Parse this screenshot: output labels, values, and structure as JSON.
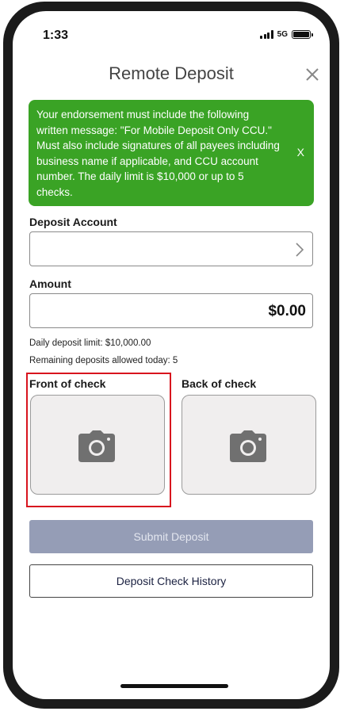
{
  "status_bar": {
    "time": "1:33",
    "network": "5G",
    "icons": [
      "signal-icon",
      "battery-icon"
    ]
  },
  "header": {
    "title": "Remote Deposit",
    "close_icon": "close-icon"
  },
  "banner": {
    "message": "Your endorsement must include the following written message: \"For Mobile Deposit Only CCU.\" Must also include signatures of all payees including business name if applicable, and CCU account number. The daily limit is $10,000 or up to 5 checks.",
    "dismiss_label": "X",
    "background_color": "#3aa325"
  },
  "deposit_account": {
    "label": "Deposit Account",
    "value": "",
    "icon": "chevron-right-icon"
  },
  "amount": {
    "label": "Amount",
    "value": "$0.00"
  },
  "limits": {
    "daily_limit": "Daily deposit limit: $10,000.00",
    "remaining": "Remaining deposits allowed today: 5"
  },
  "checks": {
    "front_label": "Front of check",
    "back_label": "Back of check",
    "icon": "camera-icon",
    "highlight_color": "#d8141e"
  },
  "actions": {
    "submit_label": "Submit Deposit",
    "submit_color": "#959db6",
    "history_label": "Deposit Check History"
  }
}
